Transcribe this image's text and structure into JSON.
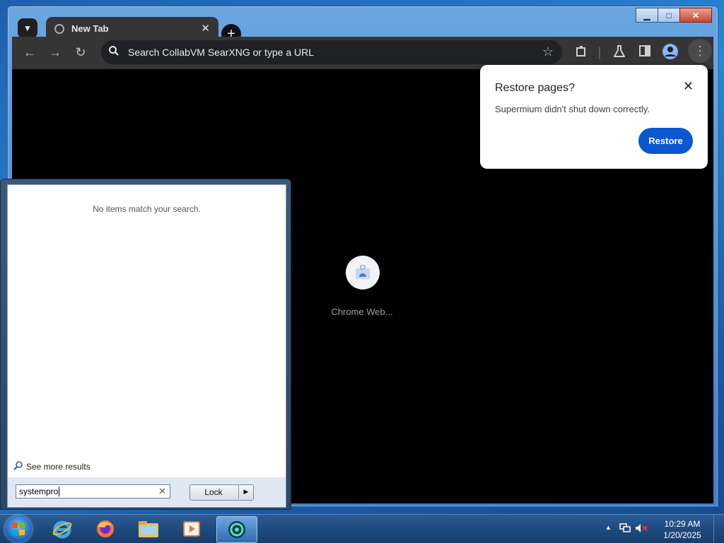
{
  "browser": {
    "tab_title": "New Tab",
    "omnibox_placeholder": "Search CollabVM SearXNG or type a URL",
    "shortcut_label": "Chrome Web...",
    "window_controls": {
      "minimize": "▁",
      "maximize": "□",
      "close": "✕"
    }
  },
  "restore_popup": {
    "title": "Restore pages?",
    "message": "Supermium didn't shut down correctly.",
    "button": "Restore"
  },
  "start_menu": {
    "no_match": "No items match your search.",
    "see_more": "See more results",
    "search_value": "systempro",
    "lock_label": "Lock"
  },
  "taskbar": {
    "time": "10:29 AM",
    "date": "1/20/2025",
    "pinned": [
      "internet-explorer",
      "firefox",
      "file-explorer",
      "media-player",
      "supermium"
    ]
  },
  "colors": {
    "restore_button": "#0b57d0",
    "browser_toolbar": "#353535",
    "omnibox": "#202124"
  }
}
